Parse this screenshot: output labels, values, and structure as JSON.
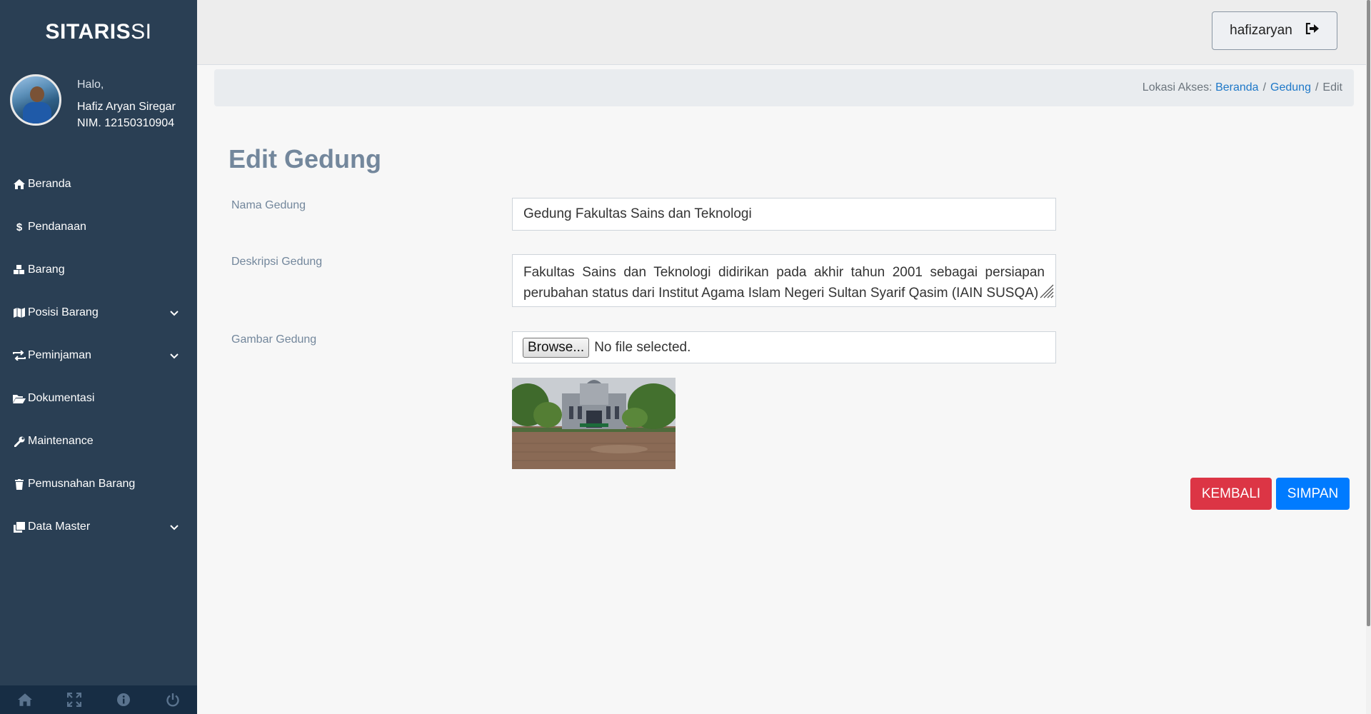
{
  "brand": {
    "prefix": "SI",
    "strong": "TARIS",
    "suffix": " SI"
  },
  "profile": {
    "greeting": "Halo,",
    "name": "Hafiz Aryan Siregar",
    "nim": "NIM. 12150310904"
  },
  "sidebar": {
    "items": [
      {
        "label": "Beranda",
        "icon": "home-icon",
        "has_submenu": false
      },
      {
        "label": "Pendanaan",
        "icon": "dollar-icon",
        "has_submenu": false
      },
      {
        "label": "Barang",
        "icon": "cubes-icon",
        "has_submenu": false
      },
      {
        "label": "Posisi Barang",
        "icon": "map-icon",
        "has_submenu": true
      },
      {
        "label": "Peminjaman",
        "icon": "exchange-icon",
        "has_submenu": true
      },
      {
        "label": "Dokumentasi",
        "icon": "folder-open-icon",
        "has_submenu": false
      },
      {
        "label": "Maintenance",
        "icon": "wrench-icon",
        "has_submenu": false
      },
      {
        "label": "Pemusnahan Barang",
        "icon": "trash-icon",
        "has_submenu": false
      },
      {
        "label": "Data Master",
        "icon": "clone-icon",
        "has_submenu": true
      }
    ],
    "footer_icons": [
      "home-icon",
      "fullscreen-icon",
      "info-icon",
      "power-icon"
    ]
  },
  "topnav": {
    "username": "hafizaryan",
    "logout_icon": "sign-out-icon"
  },
  "breadcrumb": {
    "prefix": "Lokasi Akses:",
    "items": [
      "Beranda",
      "Gedung",
      "Edit"
    ],
    "separator": "/"
  },
  "page": {
    "title": "Edit Gedung"
  },
  "form": {
    "nama_label": "Nama Gedung",
    "nama_value": "Gedung Fakultas Sains dan Teknologi",
    "deskripsi_label": "Deskripsi Gedung",
    "deskripsi_value": "Fakultas Sains dan Teknologi didirikan pada akhir tahun 2001 sebagai persiapan perubahan status dari Institut Agama Islam Negeri Sultan Syarif Qasim (IAIN SUSQA)",
    "gambar_label": "Gambar Gedung",
    "browse_label": "Browse...",
    "file_status": "No file selected."
  },
  "actions": {
    "back_label": "KEMBALI",
    "save_label": "SIMPAN"
  },
  "colors": {
    "sidebar": "#2a3f54",
    "danger": "#dc3545",
    "primary": "#007bff",
    "title": "#73879c"
  }
}
